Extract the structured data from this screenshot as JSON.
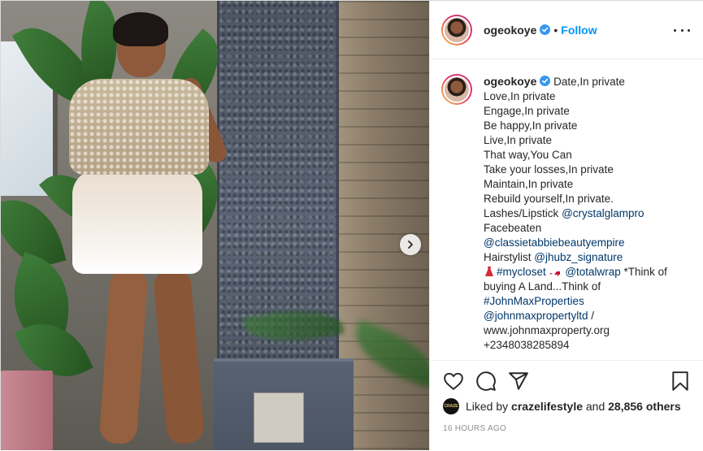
{
  "post": {
    "media": {
      "alt": "",
      "next_icon": "chevron-right-icon"
    },
    "header": {
      "username": "ogeokoye",
      "separator": "•",
      "follow_label": "Follow",
      "verified_icon": "verified-badge-icon",
      "more_icon": "more-options-icon"
    },
    "caption": {
      "username": "ogeokoye",
      "first_line": "Date,In private",
      "lines": [
        "Love,In private",
        "Engage,In private",
        "Be happy,In private",
        "Live,In private",
        "That way,You Can",
        "Take your losses,In private",
        "Maintain,In private",
        "Rebuild yourself,In private."
      ],
      "lashes_prefix": "Lashes/Lipstick ",
      "lashes_handle": "@crystalglampro",
      "facebeaten": "Facebeaten",
      "facebeaten_handle": "@classietabbiebeautyempire",
      "hairstylist_prefix": "Hairstylist ",
      "hairstylist_handle": "@jhubz_signature",
      "mycloset_tag": "#mycloset",
      "totalwrap_handle": "@totalwrap",
      "land_text_1": " *Think of",
      "land_text_2": "buying A Land...Think of",
      "johnmax_tag": "#JohnMaxProperties",
      "johnmax_handle": "@johnmaxpropertyltd",
      "johnmax_sep": " /",
      "website": "www.johnmaxproperty.org",
      "phone": "+2348038285894"
    },
    "actions": {
      "like_icon": "heart-icon",
      "comment_icon": "comment-icon",
      "share_icon": "share-icon",
      "save_icon": "bookmark-icon"
    },
    "likes": {
      "prefix": "Liked by ",
      "user": "crazelifestyle",
      "middle": " and ",
      "count": "28,856 others"
    },
    "timestamp": "16 HOURS AGO",
    "colors": {
      "link": "#00376b",
      "follow": "#0095f6",
      "verified": "#3897f0",
      "timestamp": "#8e8e8e"
    }
  }
}
